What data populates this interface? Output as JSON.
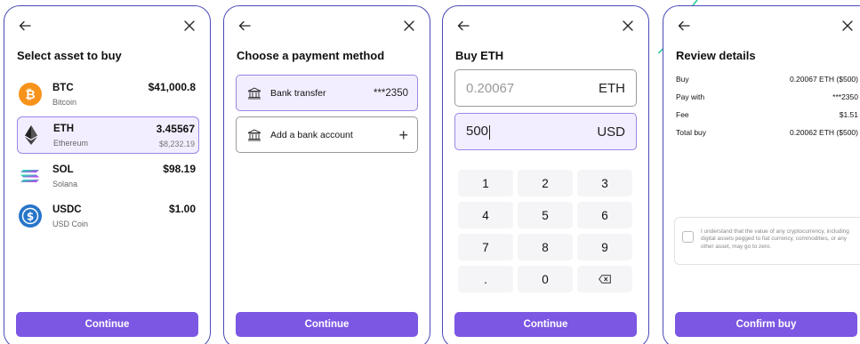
{
  "colors": {
    "accent": "#7b57e3",
    "border": "#4a4ab8",
    "selected_bg": "#f3eeff",
    "green_line": "#1ec98f"
  },
  "screen1": {
    "title": "Select asset to buy",
    "assets": [
      {
        "symbol": "BTC",
        "name": "Bitcoin",
        "value": "$41,000.8",
        "sub": "",
        "icon": "bitcoin-logo-icon"
      },
      {
        "symbol": "ETH",
        "name": "Ethereum",
        "value": "3.45567",
        "sub": "$8,232.19",
        "icon": "ethereum-logo-icon"
      },
      {
        "symbol": "SOL",
        "name": "Solana",
        "value": "$98.19",
        "sub": "",
        "icon": "solana-logo-icon"
      },
      {
        "symbol": "USDC",
        "name": "USD Coin",
        "value": "$1.00",
        "sub": "",
        "icon": "usdc-logo-icon"
      }
    ],
    "continue_label": "Continue"
  },
  "screen2": {
    "title": "Choose a payment method",
    "options": [
      {
        "label": "Bank transfer",
        "value": "***2350",
        "icon": "bank-icon"
      },
      {
        "label": "Add a bank account",
        "value": "+",
        "icon": "bank-icon"
      }
    ],
    "continue_label": "Continue"
  },
  "screen3": {
    "title": "Buy ETH",
    "crypto_amount": "0.20067",
    "crypto_currency": "ETH",
    "fiat_amount": "500",
    "fiat_currency": "USD",
    "keys": [
      "1",
      "2",
      "3",
      "4",
      "5",
      "6",
      "7",
      "8",
      "9",
      ".",
      "0",
      "backspace-icon"
    ],
    "continue_label": "Continue"
  },
  "screen4": {
    "title": "Review details",
    "rows": [
      {
        "label": "Buy",
        "value": "0.20067 ETH ($500)"
      },
      {
        "label": "Pay with",
        "value": "***2350"
      },
      {
        "label": "Fee",
        "value": "$1.51"
      },
      {
        "label": "Total buy",
        "value": "0.20062 ETH ($500)"
      }
    ],
    "agreement": "I understand that the value of any cryptocurrency, including digital assets pegged to fiat currency, commodities, or any other asset, may go to zero.",
    "confirm_label": "Confirm buy"
  }
}
